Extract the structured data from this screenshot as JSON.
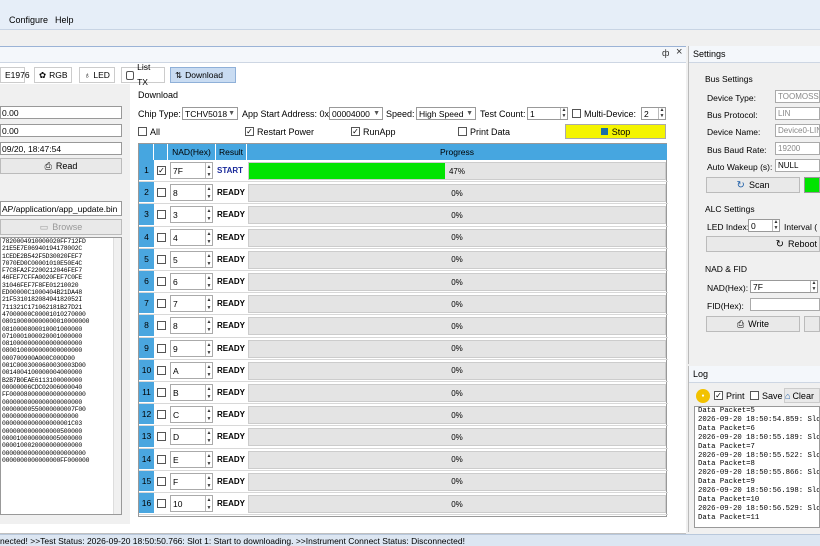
{
  "menu": {
    "items": [
      "Configure",
      "Help"
    ]
  },
  "panel_header": {
    "pin": "ф",
    "close": "×"
  },
  "tabs": [
    {
      "label": "E1976"
    },
    {
      "label": "RGB"
    },
    {
      "label": "LED"
    },
    {
      "label": "List TX"
    },
    {
      "label": "Download"
    }
  ],
  "left": {
    "field1": "0.00",
    "field2": "0.00",
    "field3": "09/20, 18:47:54",
    "read_label": "Read",
    "path": "AP/application/app_update.bin",
    "browse_label": "Browse",
    "hex_lines": [
      "7820004910000020FF712FD",
      "21E5E7E06940194178002C",
      "1CEDE2B542F5D30020FEF7",
      "7070ED0C00001010E50E4C",
      "F7C8FA2F2200212046FEF7",
      "46FEF7CFFA0020FEF7C0FE",
      "31046FEF7F8FE01210020",
      "ED00000C1000404B21DA48",
      "21F531018208494182052I",
      "711321C171062181B27D21",
      "47000000C00001010270000",
      "080100000000000010000000",
      "0810000800010001000000",
      "0710001000020001000000",
      "0810000000000000000000",
      "0800100000000000000000",
      "000700900A000C000D00",
      "001C0003000600030003D00",
      "0014004100000004000000",
      "B2B7B0EAE6113100000000",
      "00000006CDC02006000040",
      "FF000080000000000000000",
      "0000000000000000000000",
      "00000000550000000007F00",
      "000000000000000000000",
      "0000000000000000001C03",
      "0000000000000000500000",
      "0000100000000005000000",
      "0000100020000000000000",
      "00000000000000000000000",
      "0000000000000000FF000000"
    ]
  },
  "download": {
    "section_label": "Download",
    "chip_type_label": "Chip Type:",
    "chip_type": "TCHV5018",
    "addr_label": "App Start Address: 0x",
    "addr": "00004000",
    "speed_label": "Speed:",
    "speed": "High Speed",
    "test_count_label": "Test Count:",
    "test_count": "1",
    "multi_device_label": "Multi-Device:",
    "multi_device": "2",
    "all_label": "All",
    "restart_power_label": "Restart Power",
    "runapp_label": "RunApp",
    "print_data_label": "Print Data",
    "stop_label": "Stop",
    "col_nad": "NAD(Hex)",
    "col_result": "Result",
    "col_progress": "Progress",
    "rows": [
      {
        "num": "1",
        "checked": true,
        "nad": "7F",
        "result": "START",
        "progress": 47,
        "progress_text": "47%"
      },
      {
        "num": "2",
        "checked": false,
        "nad": "8",
        "result": "READY",
        "progress": 0,
        "progress_text": "0%"
      },
      {
        "num": "3",
        "checked": false,
        "nad": "3",
        "result": "READY",
        "progress": 0,
        "progress_text": "0%"
      },
      {
        "num": "4",
        "checked": false,
        "nad": "4",
        "result": "READY",
        "progress": 0,
        "progress_text": "0%"
      },
      {
        "num": "5",
        "checked": false,
        "nad": "5",
        "result": "READY",
        "progress": 0,
        "progress_text": "0%"
      },
      {
        "num": "6",
        "checked": false,
        "nad": "6",
        "result": "READY",
        "progress": 0,
        "progress_text": "0%"
      },
      {
        "num": "7",
        "checked": false,
        "nad": "7",
        "result": "READY",
        "progress": 0,
        "progress_text": "0%"
      },
      {
        "num": "8",
        "checked": false,
        "nad": "8",
        "result": "READY",
        "progress": 0,
        "progress_text": "0%"
      },
      {
        "num": "9",
        "checked": false,
        "nad": "9",
        "result": "READY",
        "progress": 0,
        "progress_text": "0%"
      },
      {
        "num": "10",
        "checked": false,
        "nad": "A",
        "result": "READY",
        "progress": 0,
        "progress_text": "0%"
      },
      {
        "num": "11",
        "checked": false,
        "nad": "B",
        "result": "READY",
        "progress": 0,
        "progress_text": "0%"
      },
      {
        "num": "12",
        "checked": false,
        "nad": "C",
        "result": "READY",
        "progress": 0,
        "progress_text": "0%"
      },
      {
        "num": "13",
        "checked": false,
        "nad": "D",
        "result": "READY",
        "progress": 0,
        "progress_text": "0%"
      },
      {
        "num": "14",
        "checked": false,
        "nad": "E",
        "result": "READY",
        "progress": 0,
        "progress_text": "0%"
      },
      {
        "num": "15",
        "checked": false,
        "nad": "F",
        "result": "READY",
        "progress": 0,
        "progress_text": "0%"
      },
      {
        "num": "16",
        "checked": false,
        "nad": "10",
        "result": "READY",
        "progress": 0,
        "progress_text": "0%"
      }
    ]
  },
  "settings": {
    "title": "Settings",
    "bus_settings": "Bus Settings",
    "device_type_label": "Device Type:",
    "device_type": "TOOMOSS",
    "bus_protocol_label": "Bus Protocol:",
    "bus_protocol": "LIN",
    "device_name_label": "Device Name:",
    "device_name": "Device0-LIN",
    "baud_label": "Bus Baud Rate:",
    "baud": "19200",
    "wakeup_label": "Auto Wakeup (s):",
    "wakeup": "NULL",
    "scan_label": "Scan",
    "alc_settings": "ALC Settings",
    "led_index_label": "LED Index:",
    "led_index": "0",
    "interval_label": "Interval (",
    "reboot_label": "Reboot",
    "nad_fid": "NAD & FID",
    "nad_label": "NAD(Hex):",
    "nad": "7F",
    "fid_label": "FID(Hex):",
    "fid": "",
    "write_label": "Write"
  },
  "log": {
    "title": "Log",
    "print_label": "Print",
    "save_label": "Save",
    "clear_label": "Clear",
    "lines": [
      "Data Packet=5",
      "2026-09-20 18:50:54.859: Slot",
      "Data Packet=6",
      "2026-09-20 18:50:55.189: Slot",
      "Data Packet=7",
      "2026-09-20 18:50:55.522: Slot",
      "Data Packet=8",
      "2026-09-20 18:50:55.866: Slot",
      "Data Packet=9",
      "2026-09-20 18:50:56.198: Slot",
      "Data Packet=10",
      "2026-09-20 18:50:56.529: Slot",
      "Data Packet=11"
    ]
  },
  "status": {
    "text": "nected! >>Test Status: 2026-09-20 18:50:50.766: Slot 1: Start to downloading. >>Instrument Connect Status: Disconnected!"
  },
  "colors": {
    "grid_header": "#46a6e0",
    "progress_fill": "#00e400",
    "stop_button": "#f4f400"
  }
}
